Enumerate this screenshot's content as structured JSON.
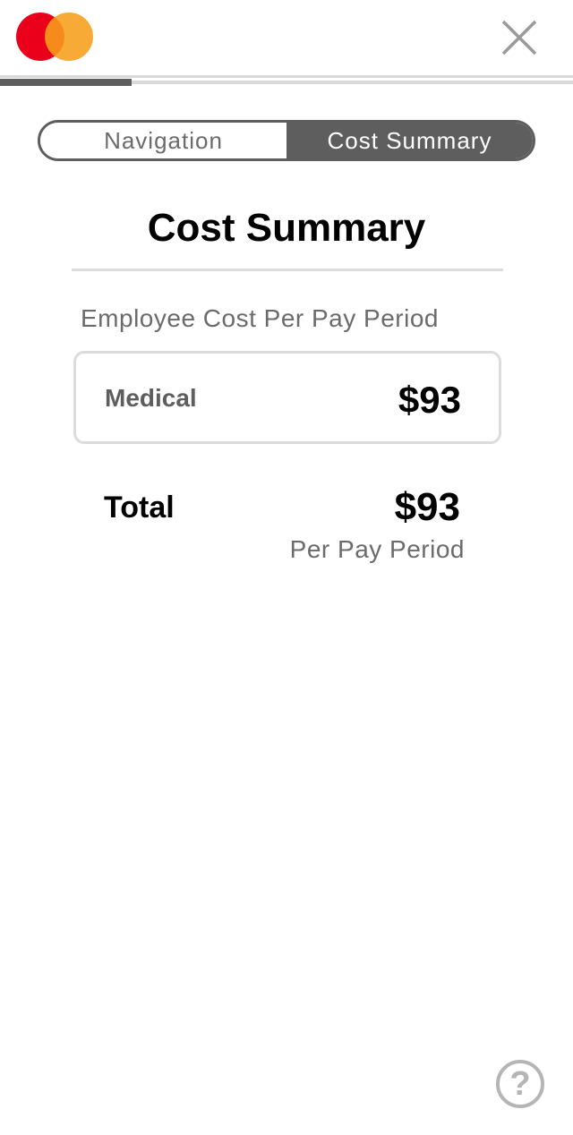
{
  "brand": {
    "logo_icon": "mastercard-logo",
    "colors": {
      "red": "#eb001b",
      "orange": "#f79e1b"
    }
  },
  "header": {
    "close_icon": "close-icon",
    "progress": 0.23
  },
  "toggle": {
    "navigation_label": "Navigation",
    "cost_summary_label": "Cost Summary",
    "selected": "Cost Summary"
  },
  "main": {
    "title": "Cost Summary",
    "subtitle": "Employee Cost Per Pay Period",
    "items": [
      {
        "label": "Medical",
        "amount": "$93"
      }
    ],
    "total": {
      "label": "Total",
      "amount": "$93",
      "note": "Per Pay Period"
    }
  },
  "help": {
    "glyph": "?",
    "icon": "help-icon"
  },
  "colors": {
    "accent_gray": "#5e5e5e",
    "muted_text": "#6b6b6b",
    "border": "#dcdcdc"
  }
}
